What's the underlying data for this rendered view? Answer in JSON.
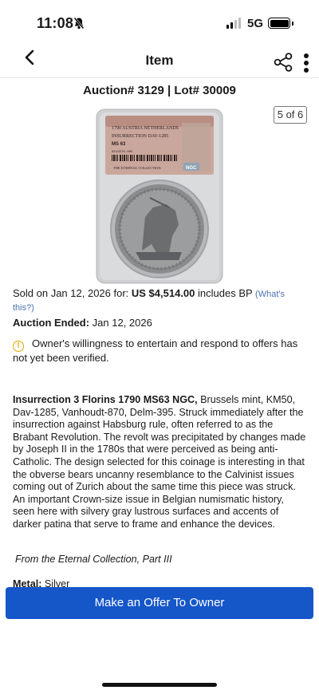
{
  "status_bar": {
    "time": "11:08",
    "network": "5G"
  },
  "nav": {
    "title": "Item"
  },
  "lot": {
    "title": "Auction# 3129 | Lot# 30009",
    "image_counter": "5 of 6",
    "slab": {
      "line1": "1790 AUSTRIA NETHERLANDS",
      "line2": "INSURRECTION DAV-1285",
      "grade": "MS 63",
      "cert": "8213570-005",
      "pedigree": "THE ETERNAL COLLECTION",
      "grader": "NGC"
    }
  },
  "sale": {
    "prefix": "Sold on Jan 12, 2026 for: ",
    "price": "US $4,514.00",
    "suffix": " includes BP ",
    "help_link": "(What's this?)"
  },
  "auction": {
    "ended_label": "Auction Ended:",
    "ended_value": " Jan 12, 2026"
  },
  "notice": {
    "icon": "info-circle-icon",
    "text": "Owner's willingness to entertain and respond to offers has not yet been verified."
  },
  "description": {
    "lead": "Insurrection 3 Florins 1790 MS63 NGC,",
    "body": " Brussels mint, KM50, Dav-1285, Vanhoudt-870, Delm-395. Struck immediately after the insurrection against Habsburg rule, often referred to as the Brabant Revolution. The revolt was precipitated by changes made by Joseph II in the 1780s that were perceived as being anti-Catholic. The design selected for this coinage is interesting in that the obverse bears uncanny resemblance to the Calvinist issues coming out of Zurich about the same time this piece was struck. An important Crown-size issue in Belgian numismatic history, seen here with silvery gray lustrous surfaces and accents of darker patina that serve to frame and enhance the devices.",
    "collection": "From the Eternal Collection, Part III",
    "metal_label": "Metal:",
    "metal_value": " Silver"
  },
  "actions": {
    "offer_button": "Make an Offer To Owner"
  },
  "colors": {
    "accent": "#1556c9",
    "link": "#4a72b0",
    "warning": "#e0a800"
  }
}
